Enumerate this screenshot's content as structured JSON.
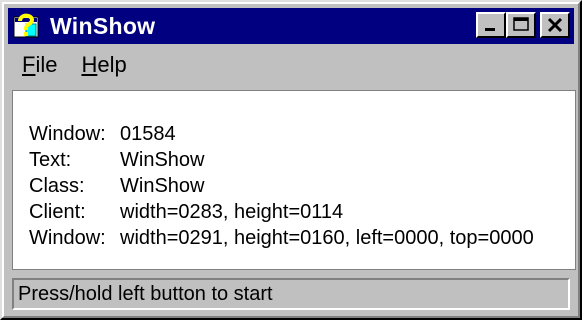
{
  "window": {
    "title": "WinShow",
    "icon": "question-mark-window-icon",
    "controls": [
      "minimize-icon",
      "maximize-icon",
      "close-icon"
    ]
  },
  "menu": {
    "file": {
      "accel": "F",
      "rest": "ile"
    },
    "help": {
      "accel": "H",
      "rest": "elp"
    }
  },
  "info": {
    "rows": [
      {
        "key": "Window:",
        "value": "01584"
      },
      {
        "key": "Text:",
        "value": "WinShow"
      },
      {
        "key": "Class:",
        "value": "WinShow"
      },
      {
        "key": "Client:",
        "value": "width=0283, height=0114"
      },
      {
        "key": "Window:",
        "value": "width=0291, height=0160, left=0000, top=0000"
      }
    ]
  },
  "status": {
    "text": "Press/hold left button to start"
  },
  "colors": {
    "titlebar": "#000080",
    "face": "#c0c0c0",
    "client": "#ffffff"
  }
}
